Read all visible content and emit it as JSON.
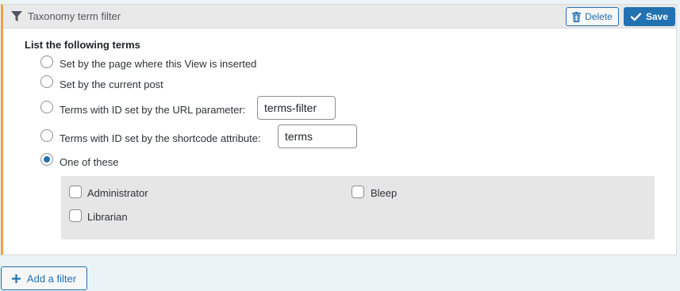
{
  "panel": {
    "title": "Taxonomy term filter",
    "filter_icon": "filter-icon",
    "delete_label": "Delete",
    "delete_icon": "trash-icon",
    "save_label": "Save",
    "save_icon": "checkmark-icon",
    "accent_color": "#f0a243"
  },
  "section": {
    "title": "List the following terms"
  },
  "options": [
    {
      "label": "Set by the page where this View is inserted",
      "checked": false
    },
    {
      "label": "Set by the current post",
      "checked": false
    },
    {
      "label": "Terms with ID set by the URL parameter:",
      "checked": false,
      "input_value": "terms-filter"
    },
    {
      "label": "Terms with ID set by the shortcode attribute:",
      "checked": false,
      "input_value": "terms"
    },
    {
      "label": "One of these",
      "checked": true
    }
  ],
  "terms": [
    {
      "label": "Administrator",
      "checked": false
    },
    {
      "label": "Bleep",
      "checked": false
    },
    {
      "label": "Librarian",
      "checked": false
    }
  ],
  "footer": {
    "add_filter_label": "Add a filter",
    "add_icon": "plus-icon"
  }
}
